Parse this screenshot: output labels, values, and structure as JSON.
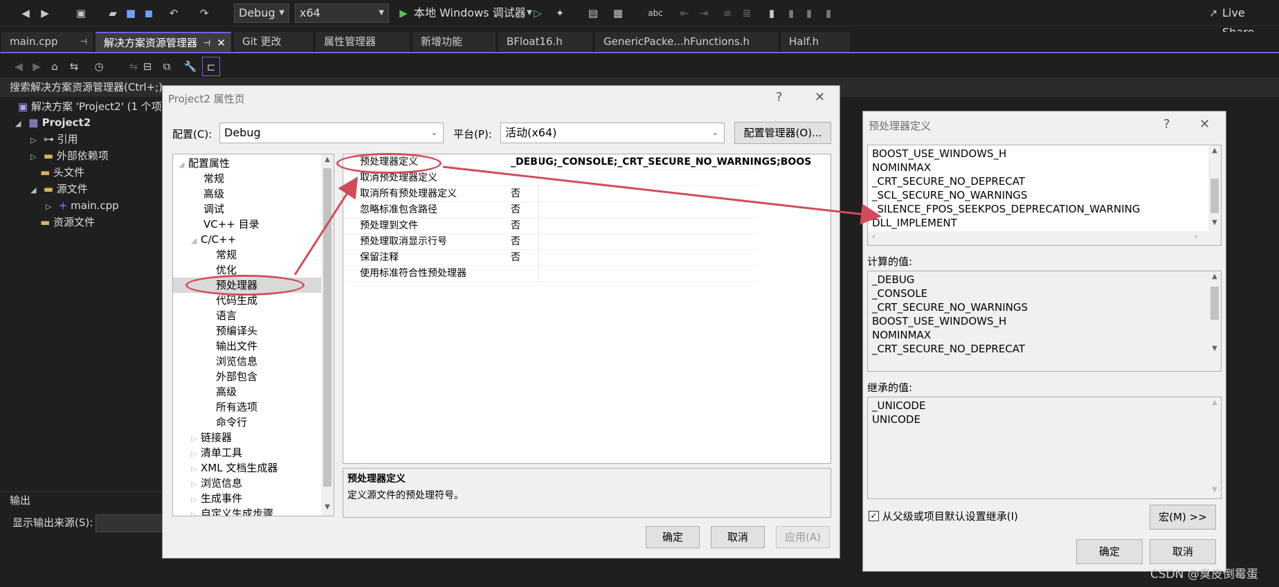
{
  "toolbar": {
    "config_value": "Debug",
    "platform_value": "x64",
    "debug_label": "本地 Windows 调试器",
    "live_share": "Live Share"
  },
  "tabs": [
    {
      "label": "main.cpp"
    },
    {
      "label": "解决方案资源管理器"
    },
    {
      "label": "Git 更改"
    },
    {
      "label": "属性管理器"
    },
    {
      "label": "新增功能"
    },
    {
      "label": "BFloat16.h"
    },
    {
      "label": "GenericPacke...hFunctions.h"
    },
    {
      "label": "Half.h"
    }
  ],
  "solution": {
    "search_placeholder": "搜索解决方案资源管理器(Ctrl+;)",
    "solution_label": "解决方案 'Project2' (1 个项",
    "project": "Project2",
    "items": [
      "引用",
      "外部依赖项",
      "头文件",
      "源文件",
      "main.cpp",
      "资源文件"
    ]
  },
  "output": {
    "title": "输出",
    "source_label": "显示输出来源(S):"
  },
  "prop_dialog": {
    "title": "Project2 属性页",
    "help": "?",
    "close": "✕",
    "config_label": "配置(C):",
    "config_value": "Debug",
    "platform_label": "平台(P):",
    "platform_value": "活动(x64)",
    "config_manager": "配置管理器(O)...",
    "nav": {
      "root": "配置属性",
      "general": "常规",
      "advanced": "高级",
      "debugging": "调试",
      "vcdirs": "VC++ 目录",
      "cpp": "C/C++",
      "cpp_children": [
        "常规",
        "优化",
        "预处理器",
        "代码生成",
        "语言",
        "预编译头",
        "输出文件",
        "浏览信息",
        "外部包含",
        "高级",
        "所有选项",
        "命令行"
      ],
      "after": [
        "链接器",
        "清单工具",
        "XML 文档生成器",
        "浏览信息",
        "生成事件",
        "自定义生成步骤"
      ]
    },
    "props": [
      {
        "name": "预处理器定义",
        "value": "_DEBUG;_CONSOLE;_CRT_SECURE_NO_WARNINGS;BOOS"
      },
      {
        "name": "取消预处理器定义",
        "value": ""
      },
      {
        "name": "取消所有预处理器定义",
        "value": "否"
      },
      {
        "name": "忽略标准包含路径",
        "value": "否"
      },
      {
        "name": "预处理到文件",
        "value": "否"
      },
      {
        "name": "预处理取消显示行号",
        "value": "否"
      },
      {
        "name": "保留注释",
        "value": "否"
      },
      {
        "name": "使用标准符合性预处理器",
        "value": ""
      }
    ],
    "desc_title": "预处理器定义",
    "desc_text": "定义源文件的预处理符号。",
    "ok": "确定",
    "cancel": "取消",
    "apply": "应用(A)"
  },
  "pp_dialog": {
    "title": "预处理器定义",
    "help": "?",
    "close": "✕",
    "defs": [
      "BOOST_USE_WINDOWS_H",
      "NOMINMAX",
      "_CRT_SECURE_NO_DEPRECAT",
      "_SCL_SECURE_NO_WARNINGS",
      "_SILENCE_FPOS_SEEKPOS_DEPRECATION_WARNING",
      "DLL_IMPLEMENT"
    ],
    "computed_label": "计算的值:",
    "computed": [
      "_DEBUG",
      "_CONSOLE",
      "_CRT_SECURE_NO_WARNINGS",
      "BOOST_USE_WINDOWS_H",
      "NOMINMAX",
      "_CRT_SECURE_NO_DEPRECAT"
    ],
    "inherited_label": "继承的值:",
    "inherited": [
      "_UNICODE",
      "UNICODE"
    ],
    "inherit_checkbox": "从父级或项目默认设置继承(I)",
    "macro": "宏(M) >>",
    "ok": "确定",
    "cancel": "取消"
  },
  "watermark": "CSDN @臭皮倒霉蛋",
  "colors": {
    "accent": "#7160e8",
    "annotation": "#d14b5a"
  }
}
